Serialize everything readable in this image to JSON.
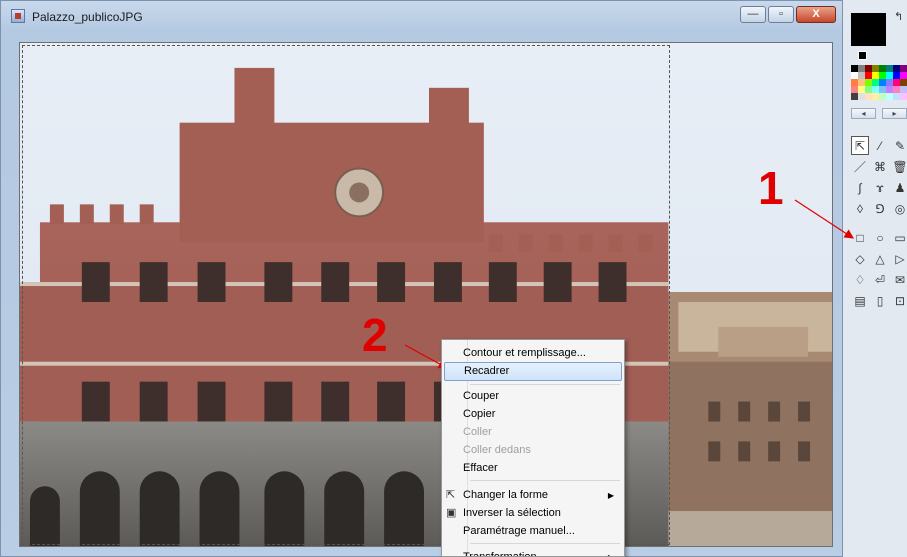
{
  "window": {
    "title": "Palazzo_publicoJPG",
    "minimize_glyph": "—",
    "maximize_glyph": "▫",
    "close_glyph": "X"
  },
  "annotations": {
    "marker_one": "1",
    "marker_two": "2",
    "arrow_color": "#e10000"
  },
  "context_menu": {
    "items": [
      {
        "label": "Contour et remplissage...",
        "enabled": true
      },
      {
        "label": "Recadrer",
        "enabled": true,
        "highlighted": true
      },
      {
        "label": "Couper",
        "enabled": true
      },
      {
        "label": "Copier",
        "enabled": true
      },
      {
        "label": "Coller",
        "enabled": false
      },
      {
        "label": "Coller dedans",
        "enabled": false
      },
      {
        "label": "Effacer",
        "enabled": true
      },
      {
        "label": "Changer la forme",
        "enabled": true,
        "submenu": true,
        "icon": "pointer-icon"
      },
      {
        "label": "Inverser la sélection",
        "enabled": true,
        "icon": "invert-selection-icon"
      },
      {
        "label": "Paramétrage manuel...",
        "enabled": true
      },
      {
        "label": "Transformation",
        "enabled": true,
        "submenu": true
      }
    ]
  },
  "palette": {
    "swap_glyph": "↰",
    "scroll_left": "◂",
    "scroll_right": "▸",
    "colors": [
      "#000000",
      "#808080",
      "#800000",
      "#808000",
      "#008000",
      "#008080",
      "#000080",
      "#800080",
      "#ffffff",
      "#c0c0c0",
      "#ff0000",
      "#ffff00",
      "#00ff00",
      "#00ffff",
      "#0000ff",
      "#ff00ff",
      "#ff8040",
      "#ffc080",
      "#80ff00",
      "#00ff80",
      "#0080ff",
      "#8080ff",
      "#ff0080",
      "#804000",
      "#ff8080",
      "#ffff80",
      "#80ff80",
      "#80ffff",
      "#80c0ff",
      "#c080ff",
      "#ff80c0",
      "#c0c0ff",
      "#404040",
      "#e0e0e0",
      "#ffe0c0",
      "#fff0a0",
      "#c0ffc0",
      "#c0ffff",
      "#c0e0ff",
      "#ffc0ff"
    ],
    "tools": [
      [
        "⇱",
        "⁄",
        "✎"
      ],
      [
        "／",
        "⌘",
        "🗑"
      ],
      [
        "∫",
        "ɤ",
        "♟"
      ],
      [
        "◊",
        "⅁",
        "◎"
      ],
      [
        "□",
        "○",
        "▭"
      ],
      [
        "◇",
        "△",
        "▷"
      ],
      [
        "♢",
        "⏎",
        "✉"
      ],
      [
        "▤",
        "▯",
        "⊡"
      ]
    ]
  }
}
